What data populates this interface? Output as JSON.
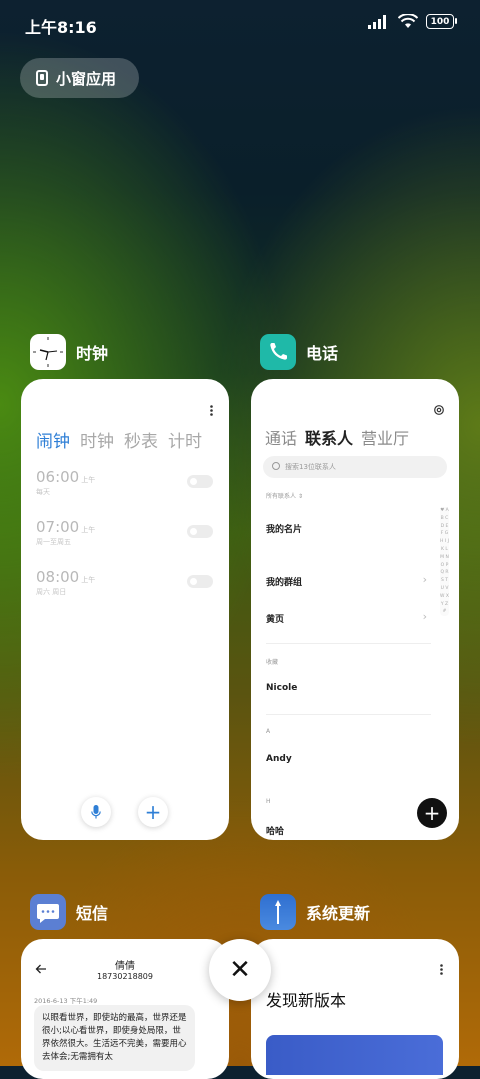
{
  "status_bar": {
    "time": "上午8:16",
    "battery": "100"
  },
  "floating_window_button": {
    "label": "小窗应用"
  },
  "apps": {
    "clock": {
      "name": "时钟",
      "tabs": [
        "闹钟",
        "时钟",
        "秒表",
        "计时"
      ],
      "alarms": [
        {
          "time": "06:00",
          "ampm": "上午",
          "repeat": "每天"
        },
        {
          "time": "07:00",
          "ampm": "上午",
          "repeat": "周一至周五"
        },
        {
          "time": "08:00",
          "ampm": "上午",
          "repeat": "周六 周日"
        }
      ]
    },
    "phone": {
      "name": "电话",
      "tabs": [
        "通话",
        "联系人",
        "营业厅"
      ],
      "search_placeholder": "搜索13位联系人",
      "filter": "所有联系人",
      "my_card": "我的名片",
      "my_groups": "我的群组",
      "yellow_pages": "黄页",
      "favorites_header": "收藏",
      "favorite_contact": "Nicole",
      "section_a": "A",
      "contact_a": "Andy",
      "section_h": "H",
      "contact_h": "哈哈",
      "alphabet": "♥ A B C D E F G H I J K L M N O P Q R S T U V W X Y Z #"
    },
    "sms": {
      "name": "短信",
      "contact_name": "倩倩",
      "contact_number": "18730218809",
      "date": "2016-6-13 下午1:49",
      "message": "以眼看世界，即使站的最高，世界还是很小;以心看世界，即使身处局限，世界依然很大。生活远不完美，需要用心去体会;无需拥有太"
    },
    "update": {
      "name": "系统更新",
      "title": "发现新版本"
    }
  },
  "close_all_button": {
    "label": "✕"
  }
}
